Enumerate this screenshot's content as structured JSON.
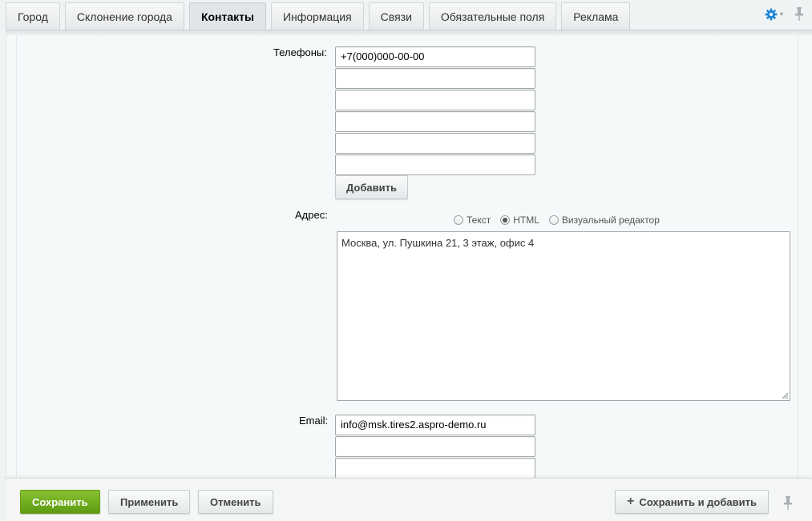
{
  "tabs": [
    {
      "label": "Город",
      "active": false
    },
    {
      "label": "Склонение города",
      "active": false
    },
    {
      "label": "Контакты",
      "active": true
    },
    {
      "label": "Информация",
      "active": false
    },
    {
      "label": "Связи",
      "active": false
    },
    {
      "label": "Обязательные поля",
      "active": false
    },
    {
      "label": "Реклама",
      "active": false
    }
  ],
  "toolbar_icons": {
    "settings": "gear-icon",
    "pin": "pin-icon",
    "caret": "▾"
  },
  "phones": {
    "label": "Телефоны:",
    "values": [
      "+7(000)000-00-00",
      "",
      "",
      "",
      "",
      ""
    ],
    "add_label": "Добавить"
  },
  "address": {
    "label": "Адрес:",
    "modes": [
      {
        "label": "Текст",
        "checked": false
      },
      {
        "label": "HTML",
        "checked": true
      },
      {
        "label": "Визуальный редактор",
        "checked": false
      }
    ],
    "value": "Москва, ул. Пушкина 21, 3 этаж, офис 4"
  },
  "email": {
    "label": "Email:",
    "values": [
      "info@msk.tires2.aspro-demo.ru",
      "",
      ""
    ]
  },
  "footer": {
    "save_label": "Сохранить",
    "apply_label": "Применить",
    "cancel_label": "Отменить",
    "save_add_label": "Сохранить и добавить",
    "plus_icon": "+"
  },
  "colors": {
    "accent_green": "#6aa61e",
    "settings_blue": "#1b84d6"
  }
}
